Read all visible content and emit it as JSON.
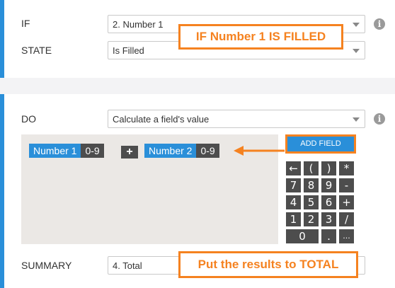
{
  "if_section": {
    "if_label": "IF",
    "if_value": "2. Number 1",
    "state_label": "STATE",
    "state_value": "Is Filled",
    "info_icon": "i"
  },
  "callouts": {
    "top": "IF Number 1 IS FILLED",
    "bottom": "Put the results to TOTAL"
  },
  "do_section": {
    "do_label": "DO",
    "do_value": "Calculate a field's value",
    "info_icon": "i",
    "add_field": "ADD FIELD",
    "summary_label": "SUMMARY",
    "summary_value": "4. Total"
  },
  "formula": {
    "field1": {
      "name": "Number 1",
      "range": "0-9"
    },
    "operator": "+",
    "field2": {
      "name": "Number 2",
      "range": "0-9"
    }
  },
  "keypad": {
    "row1": [
      "←",
      "(",
      ")",
      "*"
    ],
    "row2": [
      "7",
      "8",
      "9",
      "-"
    ],
    "row3": [
      "4",
      "5",
      "6",
      "+"
    ],
    "row4": [
      "1",
      "2",
      "3",
      "/"
    ],
    "row5": [
      "0",
      ".",
      "..."
    ]
  },
  "colors": {
    "accent": "#2a8fd9",
    "callout": "#f58220",
    "dark": "#4d4d4d"
  }
}
